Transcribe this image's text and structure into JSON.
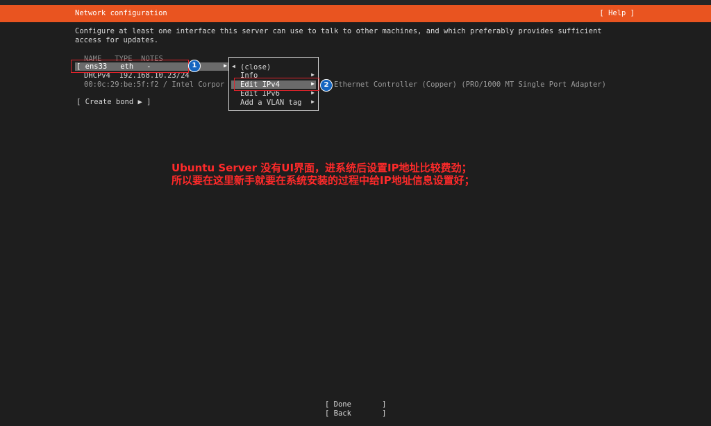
{
  "header": {
    "title": "Network configuration",
    "help": "[ Help ]"
  },
  "intro": "Configure at least one interface this server can use to talk to other machines, and which preferably provides sufficient access for updates.",
  "table": {
    "columns": "NAME   TYPE  NOTES",
    "selected_row": "[ ens33   eth   -",
    "dhcp_line": "DHCPv4  192.168.10.23/24",
    "mac_line": "00:0c:29:be:5f:f2 / Intel Corpor",
    "mac_line_tail": "Ethernet Controller (Copper) (PRO/1000 MT Single Port Adapter)",
    "create_bond": "[ Create bond ▶ ]"
  },
  "menu": {
    "items": [
      {
        "label": "(close)",
        "left_arrow": "◀",
        "arrow": ""
      },
      {
        "label": "Info",
        "arrow": "▶"
      },
      {
        "label": "Edit IPv4",
        "arrow": "▶"
      },
      {
        "label": "Edit IPv6",
        "arrow": "▶"
      },
      {
        "label": "Add a VLAN tag",
        "arrow": "▶"
      }
    ],
    "row_arrow": "▶"
  },
  "badges": {
    "one": "1",
    "two": "2"
  },
  "annotation": {
    "line1": "Ubuntu Server 没有UI界面，进系统后设置IP地址比较费劲；",
    "line2": "所以要在这里新手就要在系统安装的过程中给IP地址信息设置好；"
  },
  "footer": {
    "done": "[ Done       ]",
    "back": "[ Back       ]"
  },
  "colors": {
    "accent": "#e95420",
    "annotation": "#ff2a2a",
    "selection": "#6b6b6b"
  }
}
